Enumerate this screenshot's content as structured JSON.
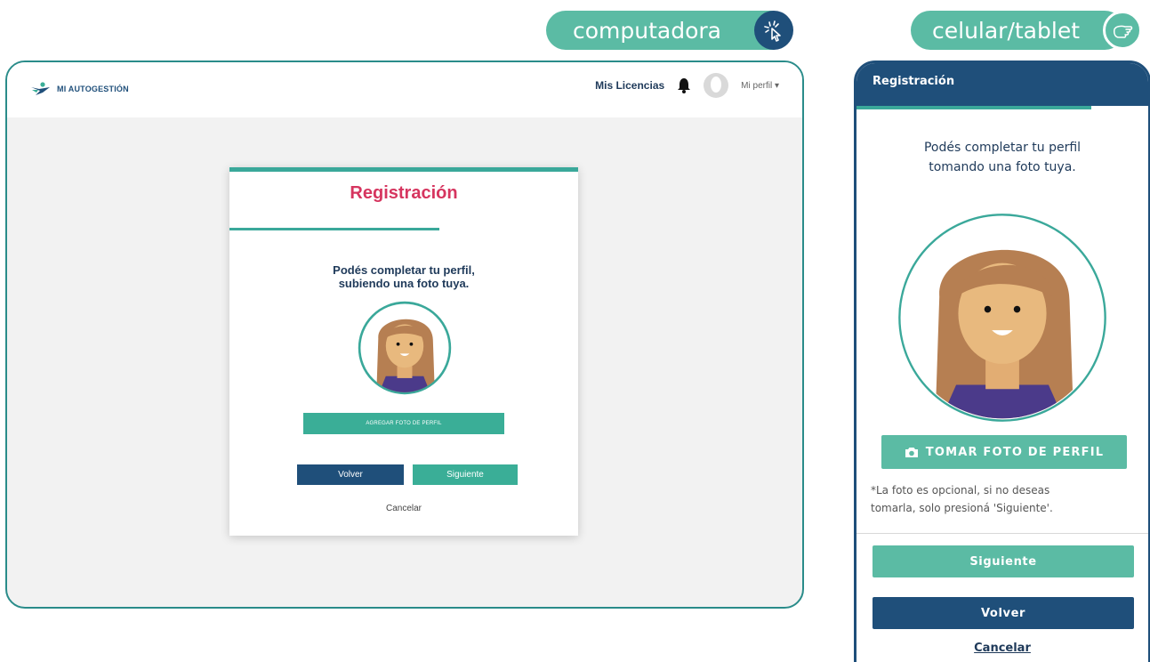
{
  "labels": {
    "desktop": "computadora",
    "mobile": "celular/tablet"
  },
  "desktop": {
    "nav": {
      "brand": "MI AUTOGESTIÓN",
      "licenses": "Mis Licencias",
      "profile": "Mi perfil"
    },
    "card": {
      "title": "Registración",
      "message_line1": "Podés completar tu perfil,",
      "message_line2": "subiendo una foto tuya.",
      "add_photo": "AGREGAR FOTO DE PERFIL",
      "back": "Volver",
      "next": "Siguiente",
      "cancel": "Cancelar"
    }
  },
  "mobile": {
    "header": "Registración",
    "message_line1": "Podés completar tu perfil",
    "message_line2": "tomando una foto tuya.",
    "take_photo": "TOMAR FOTO DE PERFIL",
    "note_line1": "*La foto es opcional, si no deseas",
    "note_line2": "tomarla, solo presioná 'Siguiente'.",
    "next": "Siguiente",
    "back": "Volver",
    "cancel": "Cancelar"
  },
  "colors": {
    "teal": "#3aae97",
    "navy": "#1f4f7a",
    "title_pink": "#d6355f"
  }
}
